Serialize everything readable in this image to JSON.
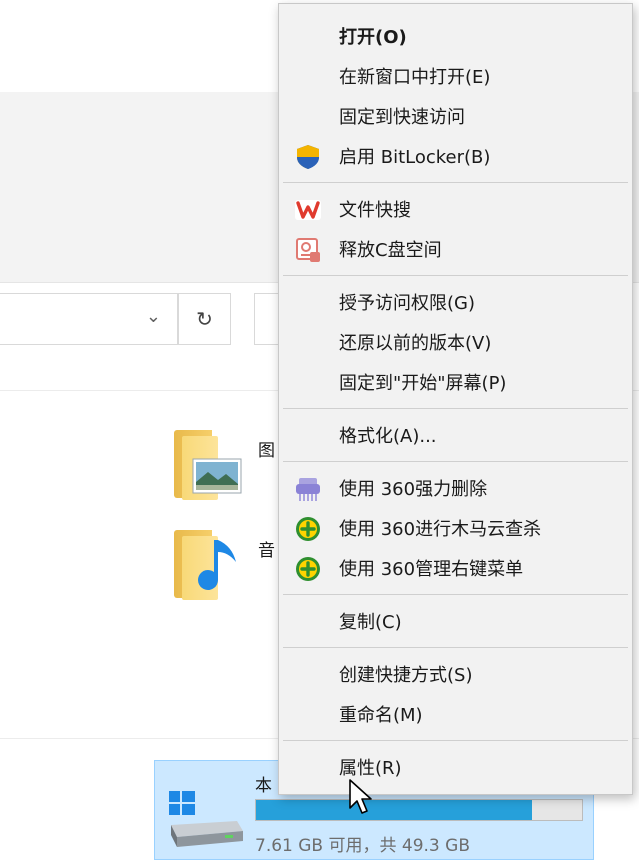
{
  "explorer": {
    "folders": [
      {
        "label": "图"
      },
      {
        "label": "音"
      }
    ],
    "drive": {
      "name": "本",
      "space_text": "7.61 GB 可用，共 49.3 GB",
      "used_fraction": 0.846
    }
  },
  "context_menu": {
    "groups": [
      [
        {
          "label": "打开(O)",
          "bold": true,
          "icon": null
        },
        {
          "label": "在新窗口中打开(E)",
          "icon": null
        },
        {
          "label": "固定到快速访问",
          "icon": null
        },
        {
          "label": "启用 BitLocker(B)",
          "icon": "bitlocker-shield-icon"
        }
      ],
      [
        {
          "label": "文件快搜",
          "icon": "wps-icon"
        },
        {
          "label": "释放C盘空间",
          "icon": "disk-cleanup-icon"
        }
      ],
      [
        {
          "label": "授予访问权限(G)",
          "icon": null
        },
        {
          "label": "还原以前的版本(V)",
          "icon": null
        },
        {
          "label": "固定到\"开始\"屏幕(P)",
          "icon": null
        }
      ],
      [
        {
          "label": "格式化(A)...",
          "icon": null
        }
      ],
      [
        {
          "label": "使用 360强力删除",
          "icon": "360-shredder-icon"
        },
        {
          "label": "使用 360进行木马云查杀",
          "icon": "360-security-icon"
        },
        {
          "label": "使用 360管理右键菜单",
          "icon": "360-security-icon"
        }
      ],
      [
        {
          "label": "复制(C)",
          "icon": null
        }
      ],
      [
        {
          "label": "创建快捷方式(S)",
          "icon": null
        },
        {
          "label": "重命名(M)",
          "icon": null
        }
      ],
      [
        {
          "label": "属性(R)",
          "icon": null
        }
      ]
    ]
  },
  "colors": {
    "menu_bg": "#f2f2f2",
    "selection_bg": "#cce8ff",
    "progress_fill": "#26a0da"
  }
}
